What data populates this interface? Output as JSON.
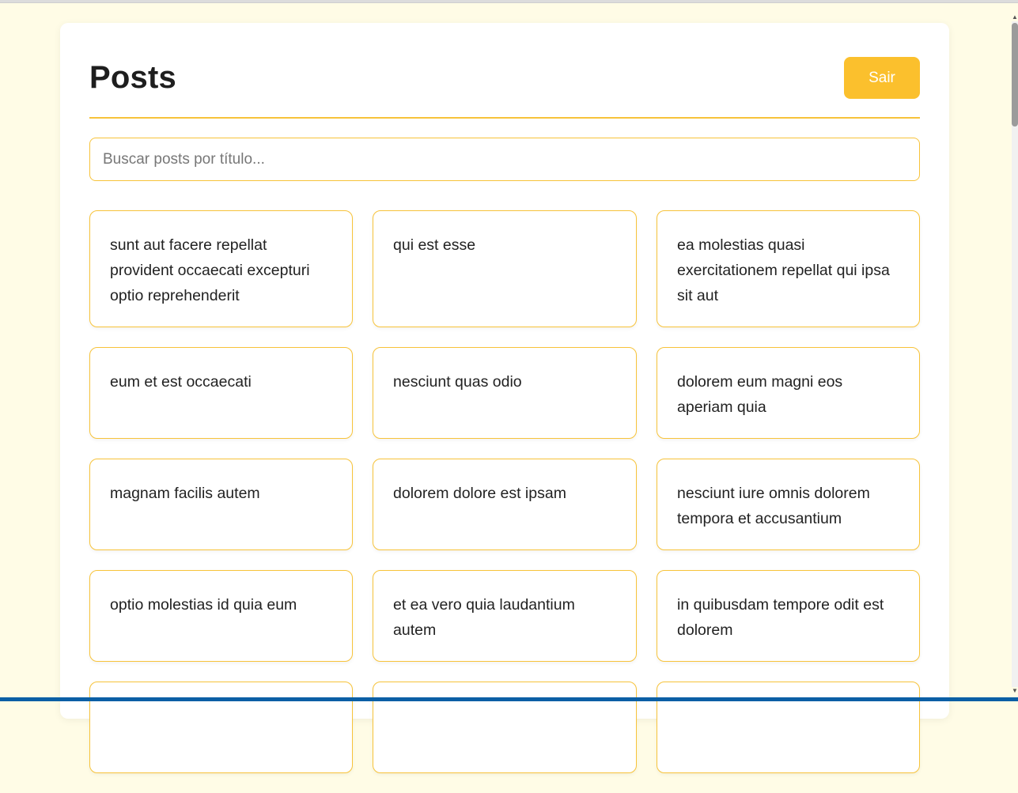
{
  "header": {
    "title": "Posts",
    "logout_label": "Sair"
  },
  "search": {
    "placeholder": "Buscar posts por título..."
  },
  "posts": [
    "sunt aut facere repellat provident occaecati excepturi optio reprehenderit",
    "qui est esse",
    "ea molestias quasi exercitationem repellat qui ipsa sit aut",
    "eum et est occaecati",
    "nesciunt quas odio",
    "dolorem eum magni eos aperiam quia",
    "magnam facilis autem",
    "dolorem dolore est ipsam",
    "nesciunt iure omnis dolorem tempora et accusantium",
    "optio molestias id quia eum",
    "et ea vero quia laudantium autem",
    "in quibusdam tempore odit est dolorem"
  ],
  "colors": {
    "accent": "#fbc02d",
    "border": "#f7c33a",
    "background": "#fffce6"
  },
  "icons": {
    "scroll_up": "chevron-up-icon",
    "scroll_down": "chevron-down-icon"
  }
}
